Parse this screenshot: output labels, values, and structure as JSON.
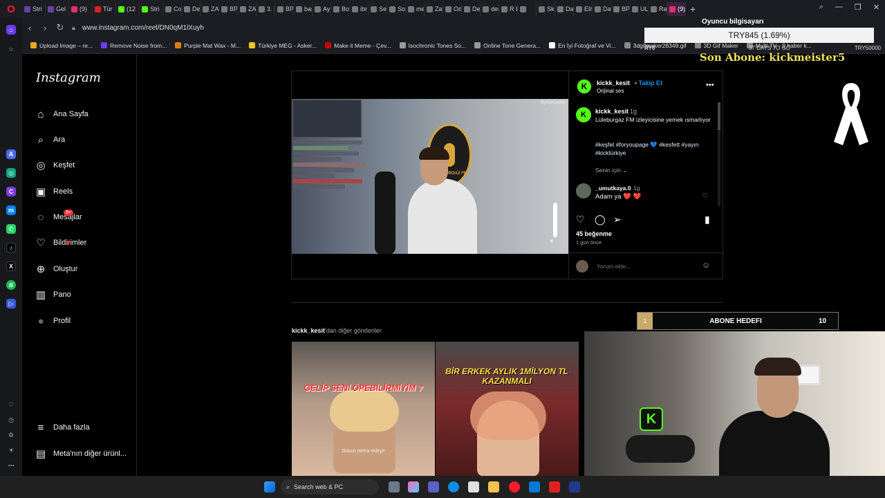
{
  "browser": {
    "url": "www.instagram.com/reel/DN0qM1lXuyh",
    "tabs": [
      {
        "label": "Stri",
        "color": "#6441a5"
      },
      {
        "label": "Gel",
        "color": "#6441a5"
      },
      {
        "label": "(9)",
        "color": "#e1306c"
      },
      {
        "label": "Tür",
        "color": "#d22"
      },
      {
        "label": "(12",
        "color": "#53fc18"
      },
      {
        "label": "Stri",
        "color": "#53fc18"
      },
      {
        "label": "Cor",
        "color": "#777"
      },
      {
        "label": "Det",
        "color": "#777"
      },
      {
        "label": "ZAF",
        "color": "#777"
      },
      {
        "label": "BP",
        "color": "#777"
      },
      {
        "label": "ZAF",
        "color": "#777"
      },
      {
        "label": "3. İ",
        "color": "#777"
      },
      {
        "label": "BP",
        "color": "#777"
      },
      {
        "label": "baş",
        "color": "#777"
      },
      {
        "label": "Ayl",
        "color": "#777"
      },
      {
        "label": "Boş",
        "color": "#777"
      },
      {
        "label": "ibr",
        "color": "#777"
      },
      {
        "label": "Ser",
        "color": "#777"
      },
      {
        "label": "Sor",
        "color": "#777"
      },
      {
        "label": "me",
        "color": "#777"
      },
      {
        "label": "Zaf",
        "color": "#777"
      },
      {
        "label": "Od",
        "color": "#777"
      },
      {
        "label": "Der",
        "color": "#777"
      },
      {
        "label": "der",
        "color": "#777"
      },
      {
        "label": "R E",
        "color": "#777"
      },
      {
        "label": "",
        "color": "#777"
      },
      {
        "label": "Sky",
        "color": "#777"
      },
      {
        "label": "Dar",
        "color": "#777"
      },
      {
        "label": "Elif",
        "color": "#777"
      },
      {
        "label": "Dar",
        "color": "#777"
      },
      {
        "label": "BP",
        "color": "#777"
      },
      {
        "label": "ULI",
        "color": "#777"
      },
      {
        "label": "Rac",
        "color": "#777"
      },
      {
        "label": "(9)",
        "color": "#e1306c",
        "active": true
      }
    ],
    "bookmarks": [
      {
        "label": "Upload Image – re...",
        "color": "#f5a623"
      },
      {
        "label": "Remove Noise from...",
        "color": "#6a3df0"
      },
      {
        "label": "Purple Mat Wax - M...",
        "color": "#e07b00"
      },
      {
        "label": "Türkiye MEG - Asker...",
        "color": "#f5c518"
      },
      {
        "label": "Make it Meme - Çev...",
        "color": "#c00"
      },
      {
        "label": "Isochronic Tones So...",
        "color": "#999"
      },
      {
        "label": "Online Tone Genera...",
        "color": "#999"
      },
      {
        "label": "En İyi Fotoğraf ve Vi...",
        "color": "#fff"
      },
      {
        "label": "3dgifmaker28349.gif",
        "color": "#888"
      },
      {
        "label": "3D Gif Maker",
        "color": "#888"
      },
      {
        "label": "Multi TV - 9 haber k...",
        "color": "#888"
      }
    ]
  },
  "instagram": {
    "logo": "Instagram",
    "nav": [
      {
        "label": "Ana Sayfa",
        "icon": "home-icon"
      },
      {
        "label": "Ara",
        "icon": "search-icon"
      },
      {
        "label": "Keşfet",
        "icon": "compass-icon"
      },
      {
        "label": "Reels",
        "icon": "reels-icon"
      },
      {
        "label": "Mesajlar",
        "icon": "messenger-icon"
      },
      {
        "label": "Bildirimler",
        "icon": "heart-icon"
      },
      {
        "label": "Oluştur",
        "icon": "plus-icon"
      },
      {
        "label": "Pano",
        "icon": "dashboard-icon"
      },
      {
        "label": "Profil",
        "icon": "avatar-icon"
      }
    ],
    "messages_badge": "9+",
    "bottom_nav": [
      {
        "label": "Daha fazla",
        "icon": "menu-icon"
      },
      {
        "label": "Meta'nın diğer ürünl...",
        "icon": "meta-icon"
      }
    ],
    "post": {
      "username": "kickk_kesit",
      "separator": "•",
      "follow_label": "Takip Et",
      "audio": "Orijinal ses",
      "video_watermark": "ByNoGame",
      "video_sign": "LÜLEBURGAZ FM",
      "caption_user": "kickk_kesit",
      "caption_time": "1g",
      "caption_text": "Lüleburgaz FM izleyicisine yemek ısmarlıyor",
      "caption_tags": "#keşfet #foryoupage 💙 #kesfett #yayın #kicktürkiye",
      "for_you": "Senin için",
      "comment_user": "_umutkaya.0",
      "comment_time": "1g",
      "comment_text": "Adam ya ❤️ ❤️",
      "likes": "45 beğenme",
      "post_time": "1 gün önce",
      "comment_placeholder": "Yorum ekle..."
    },
    "more_posts_user": "kickk_kesit",
    "more_posts_suffix": "'dan diğer gönderiler",
    "thumbs": [
      {
        "banner": "GELİP SENİ ÖPEBİLİRMİYİM ?",
        "subtitle": "Güvce metra ekleyir"
      },
      {
        "banner": "BİR ERKEK AYLIK 1MİLYON TL KAZANMALI",
        "subtitle": ""
      }
    ]
  },
  "overlay": {
    "pc_label": "Oyuncu bilgisayarı",
    "try_value": "TRY845 (1.69%)",
    "goal_left": "RY0",
    "goal_days": "37 DAYS TO GO",
    "goal_right": "TRY50000",
    "son_abone": "Son Abone: kickmeister5",
    "abone_count": "1",
    "abone_label": "ABONE HEDEFI",
    "abone_target": "10"
  },
  "taskbar": {
    "search_placeholder": "Search web & PC"
  },
  "colors": {
    "accent_blue": "#0095f6",
    "kick_green": "#53fc18",
    "badge_red": "#ff3040"
  }
}
